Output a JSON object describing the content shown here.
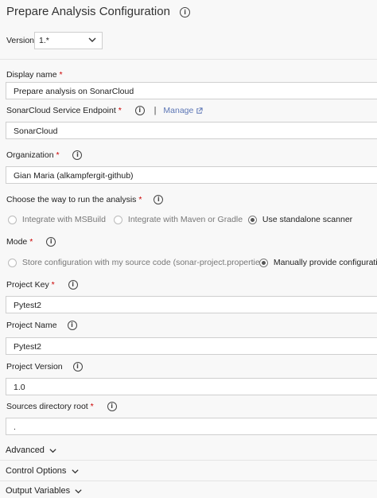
{
  "header": {
    "title": "Prepare Analysis Configuration"
  },
  "version": {
    "label": "Version",
    "value": "1.*"
  },
  "display_name": {
    "label": "Display name",
    "value": "Prepare analysis on SonarCloud"
  },
  "endpoint": {
    "label": "SonarCloud Service Endpoint",
    "manage_label": "Manage",
    "value": "SonarCloud"
  },
  "organization": {
    "label": "Organization",
    "value": "Gian Maria  (alkampfergit-github)"
  },
  "run_way": {
    "label": "Choose the way to run the analysis",
    "options": [
      "Integrate with MSBuild",
      "Integrate with Maven or Gradle",
      "Use standalone scanner"
    ],
    "selected": 2
  },
  "mode": {
    "label": "Mode",
    "options": [
      "Store configuration with my source code (sonar-project.properties)",
      "Manually provide configuration"
    ],
    "selected": 1
  },
  "project_key": {
    "label": "Project Key",
    "value": "Pytest2"
  },
  "project_name": {
    "label": "Project Name",
    "value": "Pytest2"
  },
  "project_version": {
    "label": "Project Version",
    "value": "1.0"
  },
  "sources_root": {
    "label": "Sources directory root",
    "value": "."
  },
  "sections": {
    "advanced": "Advanced",
    "control_options": "Control Options",
    "output_variables": "Output Variables"
  },
  "colors": {
    "accent_link": "#5c76b5",
    "required": "#cc0000"
  },
  "icons": {
    "info": "info-icon",
    "chevron": "chevron-down-icon",
    "external": "external-link-icon"
  }
}
